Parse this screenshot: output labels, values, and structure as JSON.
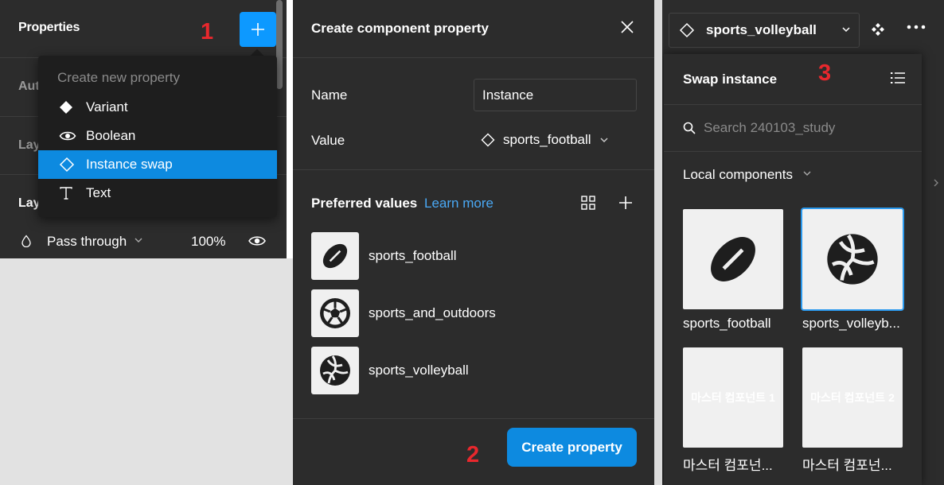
{
  "properties_panel": {
    "title": "Properties",
    "sections": [
      "Aut",
      "Lay",
      "Lay"
    ],
    "layer": {
      "blend_mode": "Pass through",
      "opacity": "100%"
    },
    "add_button_icon": "plus-icon"
  },
  "dropdown": {
    "header": "Create new property",
    "items": [
      {
        "label": "Variant",
        "icon": "diamond-filled-icon"
      },
      {
        "label": "Boolean",
        "icon": "eye-icon"
      },
      {
        "label": "Instance swap",
        "icon": "diamond-outline-icon",
        "selected": true
      },
      {
        "label": "Text",
        "icon": "text-t-icon"
      }
    ]
  },
  "callouts": [
    "1",
    "2",
    "3"
  ],
  "create_dialog": {
    "title": "Create component property",
    "name_label": "Name",
    "name_value": "Instance",
    "value_label": "Value",
    "value_selected": "sports_football",
    "preferred_label": "Preferred values",
    "learn_more": "Learn more",
    "preferred_items": [
      {
        "name": "sports_football",
        "icon": "football-icon"
      },
      {
        "name": "sports_and_outdoors",
        "icon": "soccer-ball-icon"
      },
      {
        "name": "sports_volleyball",
        "icon": "volleyball-icon"
      }
    ],
    "create_button": "Create property"
  },
  "swap_panel": {
    "instance_name": "sports_volleyball",
    "title": "Swap instance",
    "search_placeholder": "Search 240103_study",
    "section": "Local components",
    "components": [
      {
        "name": "sports_football",
        "icon": "football-icon",
        "selected": false
      },
      {
        "name": "sports_volleyb...",
        "icon": "volleyball-icon",
        "selected": true
      },
      {
        "name": "마스터 컴포넌...",
        "thumb_text": "마스터 컴포넌트 1",
        "selected": false
      },
      {
        "name": "마스터 컴포넌...",
        "thumb_text": "마스터 컴포넌트 2",
        "selected": false
      }
    ]
  },
  "colors": {
    "panel_bg": "#2c2c2c",
    "accent": "#0d99ff",
    "callout": "#e8282d",
    "link": "#4aa9f5"
  }
}
